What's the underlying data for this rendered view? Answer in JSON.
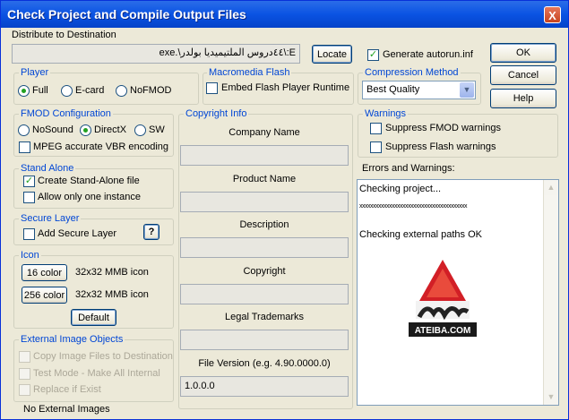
{
  "window": {
    "title": "Check Project and Compile Output Files",
    "close_glyph": "X"
  },
  "distribute": {
    "label": "Distribute to Destination",
    "path": "E:\\٤٤دروس الملتيميديا بولدر\\.exe",
    "locate_label": "Locate"
  },
  "generate_autorun": {
    "label": "Generate autorun.inf",
    "checked": true
  },
  "buttons": {
    "ok": "OK",
    "cancel": "Cancel",
    "help": "Help"
  },
  "player": {
    "title": "Player",
    "options": [
      "Full",
      "E-card",
      "NoFMOD"
    ],
    "selected": "Full"
  },
  "macromedia": {
    "title": "Macromedia Flash",
    "embed_label": "Embed Flash Player Runtime",
    "embed_checked": false
  },
  "compression": {
    "title": "Compression Method",
    "selected": "Best Quality"
  },
  "fmod": {
    "title": "FMOD Configuration",
    "options": [
      "NoSound",
      "DirectX",
      "SW"
    ],
    "selected": "DirectX",
    "vbr_label": "MPEG accurate VBR encoding",
    "vbr_checked": false
  },
  "copyright_info": {
    "title": "Copyright Info",
    "company_label": "Company Name",
    "product_label": "Product Name",
    "description_label": "Description",
    "copyright_label": "Copyright",
    "trademarks_label": "Legal Trademarks",
    "file_version_label": "File Version (e.g. 4.90.0000.0)",
    "file_version_value": "1.0.0.0"
  },
  "warnings": {
    "title": "Warnings",
    "suppress_fmod": "Suppress FMOD warnings",
    "suppress_flash": "Suppress Flash warnings"
  },
  "errors": {
    "label": "Errors and Warnings:",
    "lines": [
      "Checking project...",
      "xxxxxxxxxxxxxxxxxxxxxxxxxxxxxxxxxxxxxxxx",
      "Checking external paths OK"
    ],
    "logo_text": "ATEIBA.COM"
  },
  "standalone": {
    "title": "Stand Alone",
    "create_label": "Create Stand-Alone file",
    "create_checked": true,
    "one_instance_label": "Allow only one instance",
    "one_instance_checked": false
  },
  "secure": {
    "title": "Secure Layer",
    "add_label": "Add Secure Layer",
    "help_glyph": "?"
  },
  "icon": {
    "title": "Icon",
    "color16_label": "16 color",
    "icon16_text": "32x32 MMB icon",
    "color256_label": "256 color",
    "icon256_text": "32x32 MMB icon",
    "default_label": "Default"
  },
  "external": {
    "title": "External Image Objects",
    "copy_label": "Copy Image Files to Destination",
    "test_mode_label": "Test Mode - Make All Internal",
    "replace_label": "Replace if Exist",
    "status": "No External Images"
  }
}
